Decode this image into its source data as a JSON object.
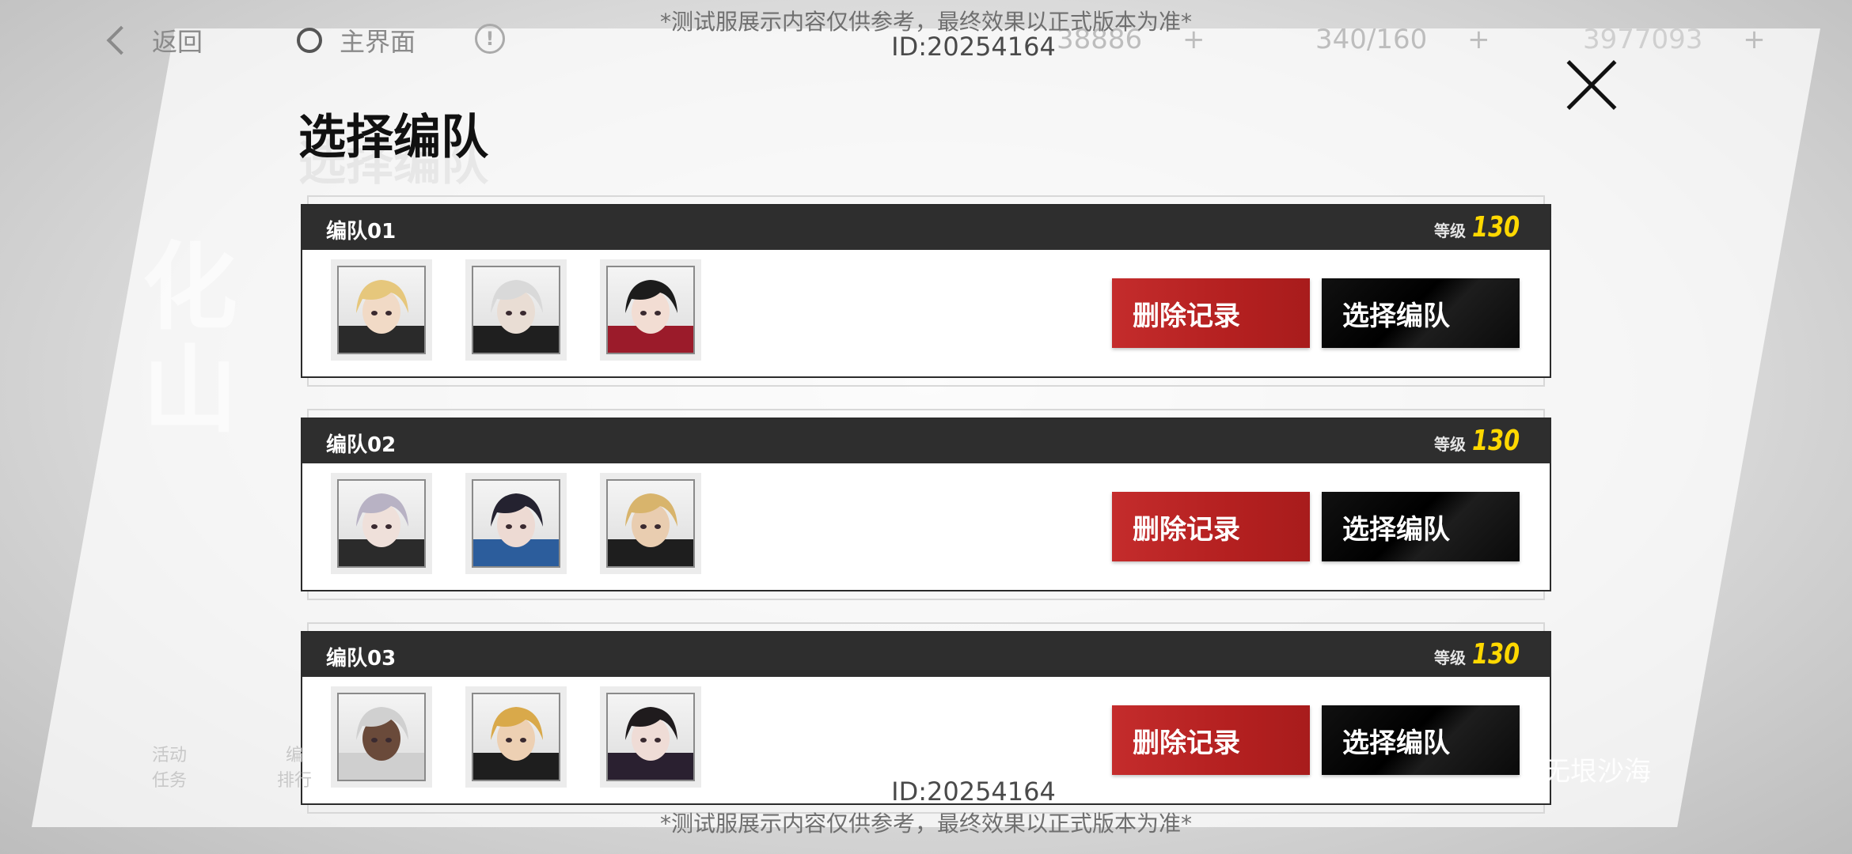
{
  "topbar": {
    "back_label": "返回",
    "home_label": "主界面",
    "resource1": "38886",
    "resource2": "340/160",
    "resource3": "3977093",
    "plus": "+"
  },
  "overlay": {
    "disclaimer": "*测试服展示内容仅供参考，最终效果以正式版本为准*",
    "player_id": "ID:20254164"
  },
  "page_title": "选择编队",
  "level_label": "等级",
  "teams": [
    {
      "name": "编队01",
      "level": "130",
      "delete_label": "删除记录",
      "select_label": "选择编队",
      "avatars": [
        {
          "hair": "#e6c77c",
          "skin": "#f1dac6",
          "outfit": "#2a2a2a"
        },
        {
          "hair": "#d9d9d9",
          "skin": "#e9ddd4",
          "outfit": "#1f1f1f"
        },
        {
          "hair": "#1c1c1c",
          "skin": "#f2ddd3",
          "outfit": "#9b1b2a"
        }
      ]
    },
    {
      "name": "编队02",
      "level": "130",
      "delete_label": "删除记录",
      "select_label": "选择编队",
      "avatars": [
        {
          "hair": "#b8b2c4",
          "skin": "#efe0da",
          "outfit": "#2b2b2b"
        },
        {
          "hair": "#242230",
          "skin": "#eddad3",
          "outfit": "#2c5d9c"
        },
        {
          "hair": "#d8b46c",
          "skin": "#e9cdb0",
          "outfit": "#1e1e1e"
        }
      ]
    },
    {
      "name": "编队03",
      "level": "130",
      "delete_label": "删除记录",
      "select_label": "选择编队",
      "avatars": [
        {
          "hair": "#d0d0d0",
          "skin": "#6a4a3a",
          "outfit": "#cfcfcf"
        },
        {
          "hair": "#d9a94a",
          "skin": "#edd0b3",
          "outfit": "#1e1e1e"
        },
        {
          "hair": "#1f1b1d",
          "skin": "#efdcd6",
          "outfit": "#2a2030"
        }
      ]
    }
  ],
  "background": {
    "left_glyphs": "化\n山",
    "bottom_left_1": "活动\n任务",
    "bottom_left_2": "编\n排行",
    "logo_text": "无垠沙海"
  }
}
